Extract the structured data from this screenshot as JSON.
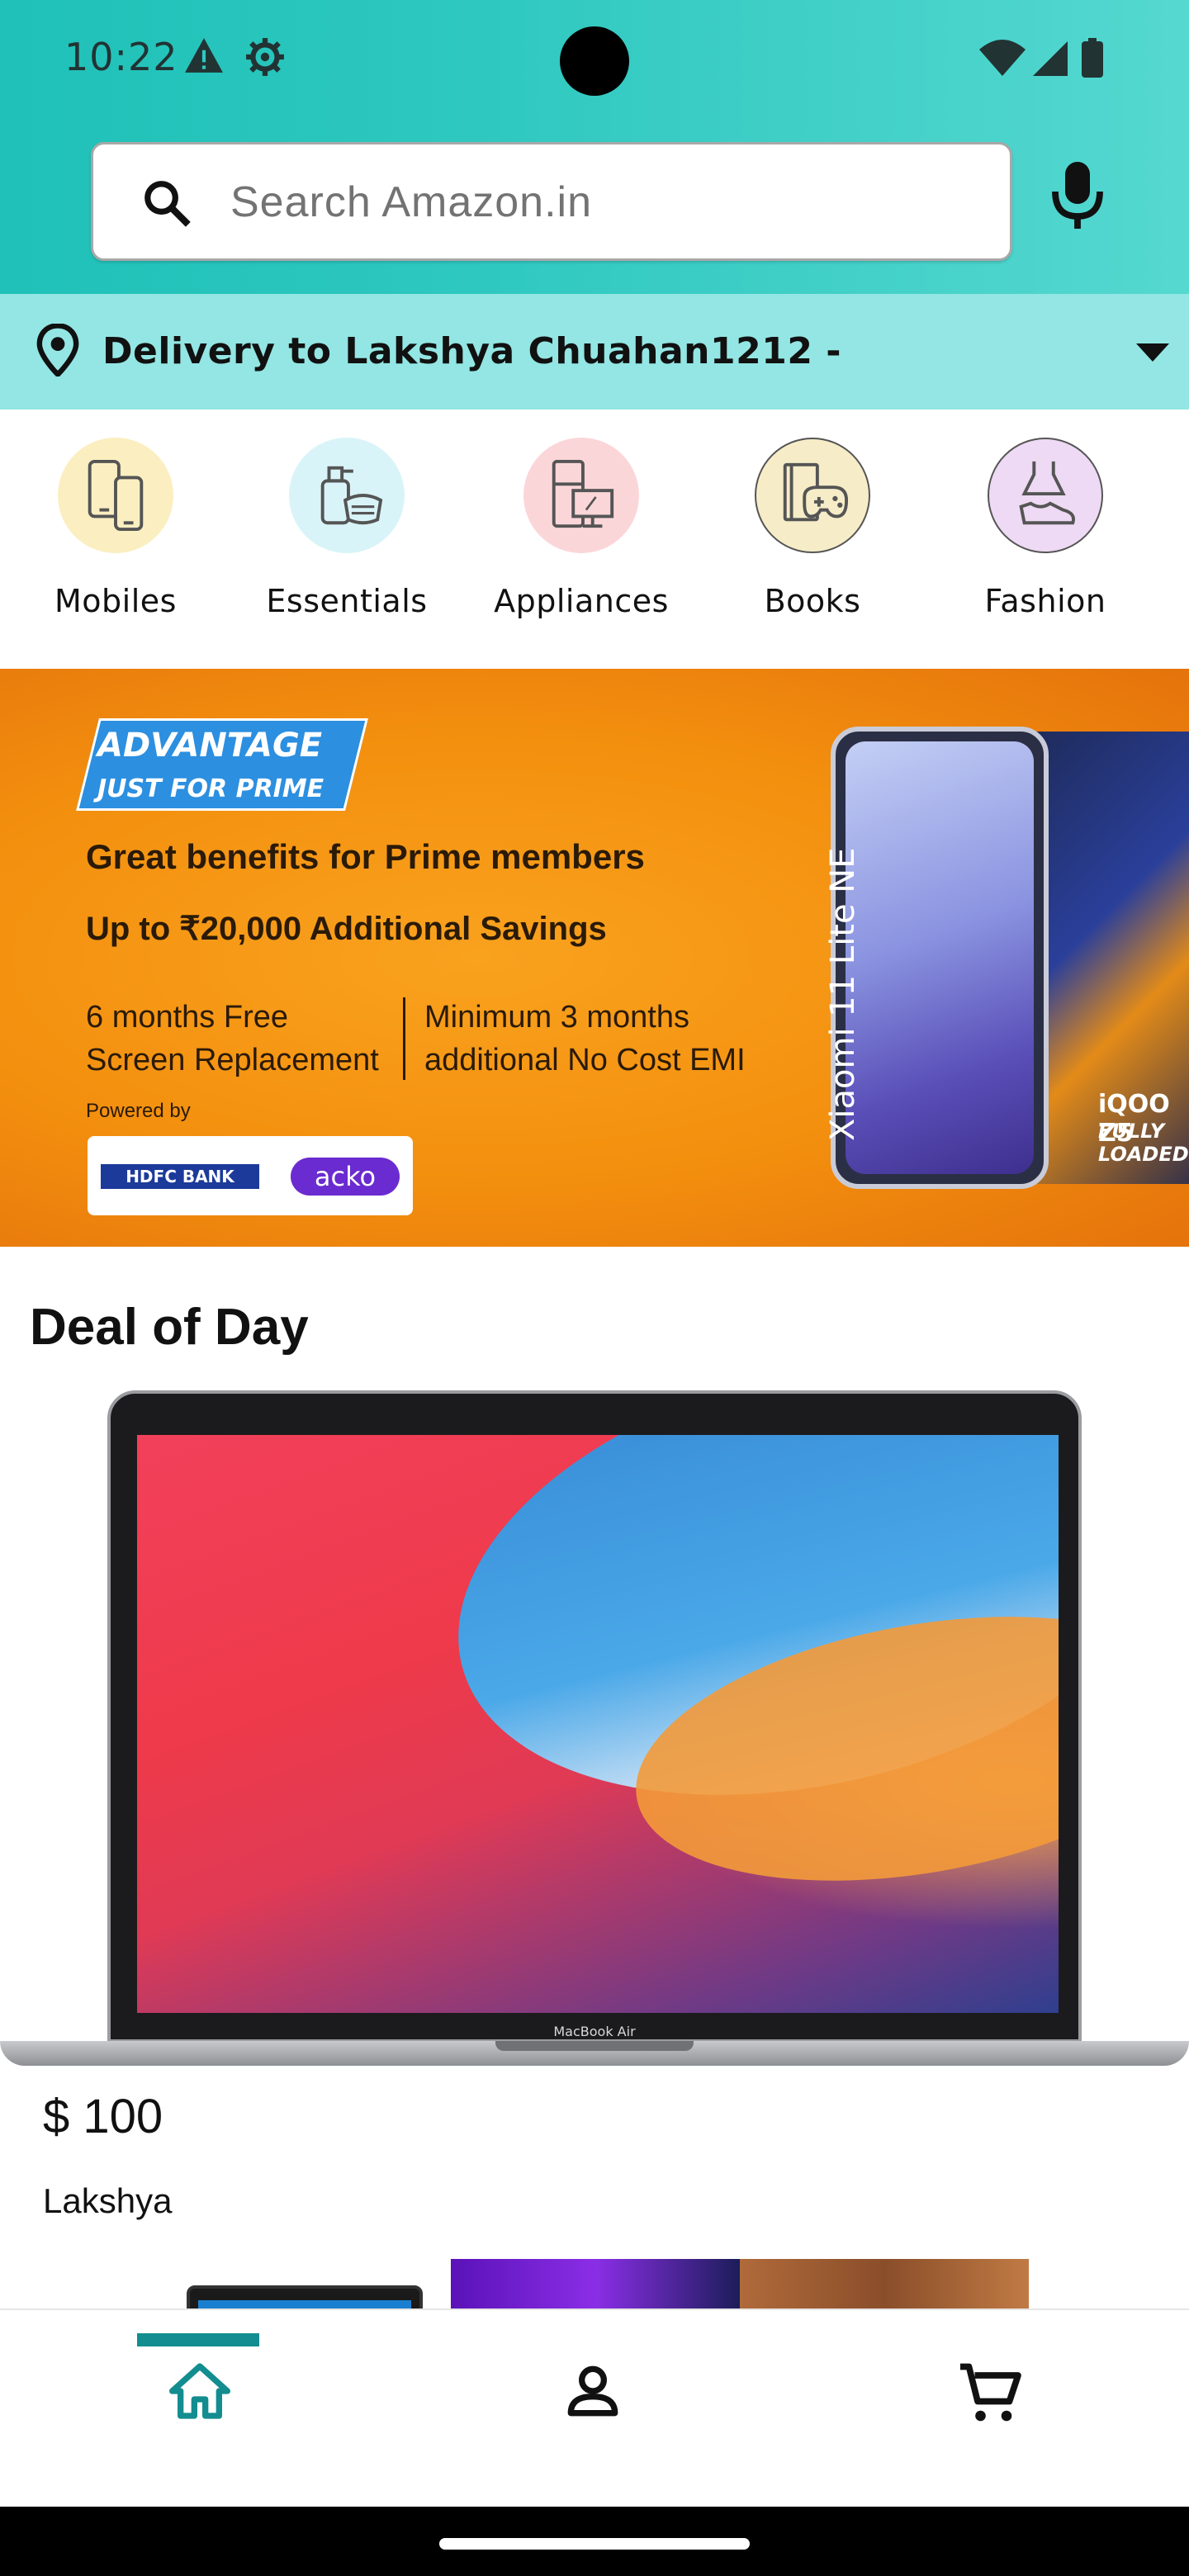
{
  "status_bar": {
    "time": "10:22",
    "icons": [
      "warning-icon",
      "settings-gear-icon",
      "wifi-icon",
      "cellular-signal-icon",
      "battery-icon"
    ]
  },
  "search": {
    "placeholder": "Search Amazon.in",
    "icons": [
      "search-icon",
      "microphone-icon"
    ]
  },
  "delivery": {
    "text": "Delivery to Lakshya Chuahan1212 -",
    "icons": [
      "location-pin-icon",
      "dropdown-caret-icon"
    ]
  },
  "categories": [
    {
      "label": "Mobiles",
      "icon": "mobiles-icon",
      "color": "#fbeec0"
    },
    {
      "label": "Essentials",
      "icon": "essentials-icon",
      "color": "#d9f4f8"
    },
    {
      "label": "Appliances",
      "icon": "appliances-icon",
      "color": "#fbd6d9"
    },
    {
      "label": "Books",
      "icon": "books-icon",
      "color": "#f6edc8"
    },
    {
      "label": "Fashion",
      "icon": "fashion-icon",
      "color": "#eedaf4"
    }
  ],
  "banner": {
    "badge_line1": "ADVANTAGE",
    "badge_line2": "JUST FOR PRIME",
    "headline": "Great benefits for Prime members",
    "subline": "Up to ₹20,000 Additional Savings",
    "left_offer": "6 months Free Screen Replacement",
    "right_offer": "Minimum 3 months additional No Cost EMI",
    "powered_by": "Powered by",
    "partner1": "HDFC BANK",
    "partner2": "acko",
    "phone1_name": "Xiaomi 11 Lite NE",
    "phone2_name": "iQOO Z5",
    "phone2_tagline": "FULLY LOADED"
  },
  "deal": {
    "title": "Deal of Day",
    "product_brand": "MacBook Air",
    "price": "$ 100",
    "seller": "Lakshya"
  },
  "bottom_nav": {
    "items": [
      {
        "name": "home",
        "icon": "home-icon",
        "active": true
      },
      {
        "name": "account",
        "icon": "account-icon",
        "active": false
      },
      {
        "name": "cart",
        "icon": "cart-icon",
        "active": false
      }
    ],
    "active_color": "#138d8f"
  },
  "colors": {
    "appbar": "#1fc1b8",
    "delivery_bar": "#93e6e3",
    "banner_orange": "#f38f0e"
  }
}
